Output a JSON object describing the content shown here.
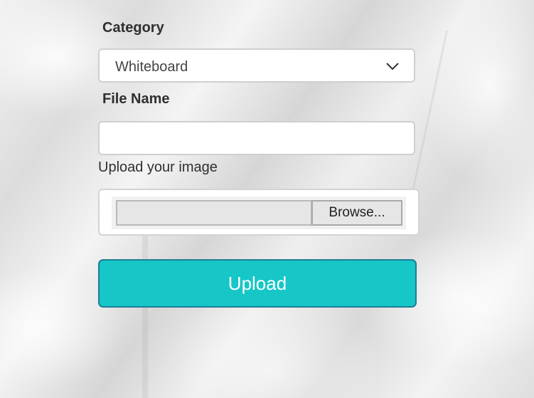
{
  "form": {
    "category_label": "Category",
    "category_value": "Whiteboard",
    "filename_label": "File Name",
    "filename_value": "",
    "upload_prompt": "Upload your image",
    "browse_label": "Browse...",
    "upload_label": "Upload"
  },
  "colors": {
    "upload_button": "#17c6c7",
    "upload_border": "#1d7f96",
    "label_text": "#2f2f2f"
  },
  "icons": {
    "dropdown": "chevron-down-icon"
  }
}
